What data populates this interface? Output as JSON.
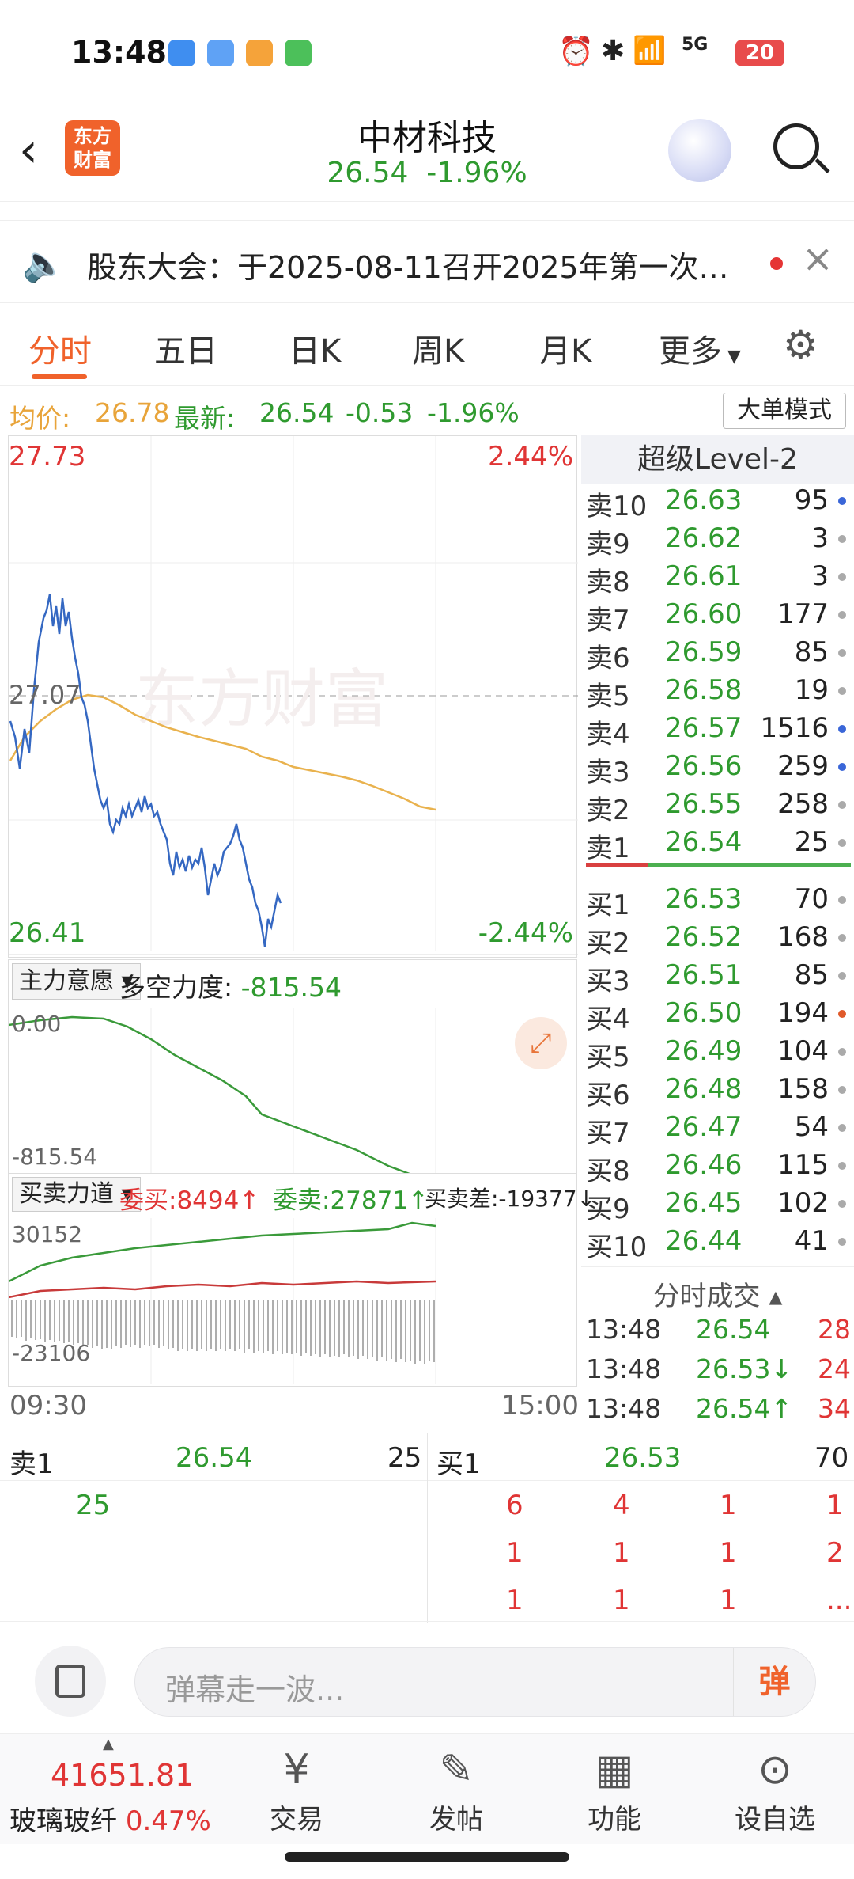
{
  "status": {
    "time": "13:48",
    "battery": "20",
    "network": "5G"
  },
  "header": {
    "name": "中材科技",
    "price": "26.54",
    "change_pct": "-1.96%",
    "logo_text": "东方财富"
  },
  "notice": {
    "text": "股东大会：于2025-08-11召开2025年第一次临..."
  },
  "tabs": [
    "分时",
    "五日",
    "日K",
    "周K",
    "月K",
    "更多"
  ],
  "info": {
    "avg_label": "均价:",
    "avg": "26.78",
    "last_label": "最新:",
    "last": "26.54",
    "chg": "-0.53",
    "pct": "-1.96%",
    "mode_button": "大单模式"
  },
  "chart": {
    "high": "27.73",
    "high_pct": "2.44%",
    "low": "26.41",
    "low_pct": "-2.44%",
    "prev_close": "27.07",
    "watermark": "东方财富",
    "main_force_label": "主力意愿",
    "force_label": "多空力度:",
    "force_value": "-815.54",
    "force_top": "0.00",
    "force_bottom": "-815.54",
    "bs_label": "买卖力道",
    "buy_label": "委买:8494↑",
    "sell_label": "委卖:27871↑",
    "diff_label": "买卖差:-19377↓",
    "bs_top": "30152",
    "bs_bottom": "-23106",
    "start_time": "09:30",
    "end_time": "15:00"
  },
  "level2_title": "超级Level-2",
  "asks": [
    {
      "name": "卖10",
      "price": "26.63",
      "vol": "95",
      "dot": "#3a66d8"
    },
    {
      "name": "卖9",
      "price": "26.62",
      "vol": "3",
      "dot": "#aaaaaa"
    },
    {
      "name": "卖8",
      "price": "26.61",
      "vol": "3",
      "dot": "#aaaaaa"
    },
    {
      "name": "卖7",
      "price": "26.60",
      "vol": "177",
      "dot": "#aaaaaa"
    },
    {
      "name": "卖6",
      "price": "26.59",
      "vol": "85",
      "dot": "#aaaaaa"
    },
    {
      "name": "卖5",
      "price": "26.58",
      "vol": "19",
      "dot": "#aaaaaa"
    },
    {
      "name": "卖4",
      "price": "26.57",
      "vol": "1516",
      "dot": "#3a66d8"
    },
    {
      "name": "卖3",
      "price": "26.56",
      "vol": "259",
      "dot": "#3a66d8"
    },
    {
      "name": "卖2",
      "price": "26.55",
      "vol": "258",
      "dot": "#aaaaaa"
    },
    {
      "name": "卖1",
      "price": "26.54",
      "vol": "25",
      "dot": "#aaaaaa"
    }
  ],
  "bids": [
    {
      "name": "买1",
      "price": "26.53",
      "vol": "70",
      "dot": "#aaaaaa"
    },
    {
      "name": "买2",
      "price": "26.52",
      "vol": "168",
      "dot": "#aaaaaa"
    },
    {
      "name": "买3",
      "price": "26.51",
      "vol": "85",
      "dot": "#aaaaaa"
    },
    {
      "name": "买4",
      "price": "26.50",
      "vol": "194",
      "dot": "#e05a2a"
    },
    {
      "name": "买5",
      "price": "26.49",
      "vol": "104",
      "dot": "#aaaaaa"
    },
    {
      "name": "买6",
      "price": "26.48",
      "vol": "158",
      "dot": "#aaaaaa"
    },
    {
      "name": "买7",
      "price": "26.47",
      "vol": "54",
      "dot": "#aaaaaa"
    },
    {
      "name": "买8",
      "price": "26.46",
      "vol": "115",
      "dot": "#aaaaaa"
    },
    {
      "name": "买9",
      "price": "26.45",
      "vol": "102",
      "dot": "#aaaaaa"
    },
    {
      "name": "买10",
      "price": "26.44",
      "vol": "41",
      "dot": "#aaaaaa"
    }
  ],
  "ticks_title": "分时成交",
  "ticks": [
    {
      "time": "13:48",
      "price": "26.54",
      "vol": "28"
    },
    {
      "time": "13:48",
      "price": "26.53↓",
      "vol": "24"
    },
    {
      "time": "13:48",
      "price": "26.54↑",
      "vol": "34"
    }
  ],
  "queue": {
    "sell_label": "卖1",
    "sell_price": "26.54",
    "sell_vol": "25",
    "sell_queue": [
      "25"
    ],
    "buy_label": "买1",
    "buy_price": "26.53",
    "buy_vol": "70",
    "buy_queue": [
      "6",
      "4",
      "1",
      "1",
      "1",
      "1",
      "1",
      "2",
      "1",
      "1",
      "1",
      "..."
    ]
  },
  "comment": {
    "placeholder": "弹幕走一波...",
    "danmu": "弹"
  },
  "bottom": {
    "index_value": "41651.81",
    "index_name": "玻璃玻纤",
    "index_pct": "0.47%",
    "nav": [
      "交易",
      "发帖",
      "功能",
      "设自选"
    ]
  }
}
